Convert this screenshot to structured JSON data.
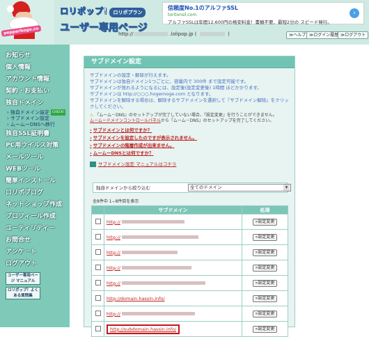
{
  "header": {
    "mascot_tag": "pepperbogo.co",
    "logo_line1": "ロリポップ!",
    "logo_badge": "ロリポプラン",
    "logo_line2": "ユーザー専用ページ",
    "url_prefix": "http://",
    "url_suffix": ".lolipop.jp",
    "help": "ヘルプ",
    "login_history": "ログイン履歴",
    "logout": "ログアウト"
  },
  "ad": {
    "title": "信頼度No.1のアルファSSL",
    "url": "toritonsil.com",
    "desc": "アルファSSLは年間12,600円の格安料金！書類不要、最短2分の スピード発行。"
  },
  "sidebar": {
    "items": [
      "お知らせ",
      "個人情報",
      "アカウント情報",
      "契約・お支払い",
      "独自ドメイン",
      "独自SSL証明書",
      "PC用ウイルス対策",
      "メールツール",
      "WEBツール",
      "簡単インストール",
      "ロリポブログ",
      "ネットショップ作成",
      "プロフィール作成",
      "ユーティリティー",
      "お問合せ",
      "アンケート",
      "ログアウト"
    ],
    "sub_items": [
      "独自ドメイン設定",
      "サブドメイン設定",
      "ムームーDNSへ移行"
    ],
    "sub_new": "CHECK!",
    "manual_button": "ユーザー専用ページ マニュアル",
    "faq_button": "ロリポップ！よくある質問集"
  },
  "panel": {
    "title": "サブドメイン設定",
    "intro": [
      "サブドメインの設定・解除が行えます。",
      "サブドメインは独自ドメイン1つごとに、容量内で 300件 まで設定可能です。",
      "サブドメインが見れるようになるには、設定後(設定変更後) 1時間 ほどかかります。",
      "サブドメインは http://○○○.hogemoge.com となります。",
      "サブドメインを解除する場合は、解除するサブドメインを選択して『サブドメイン解除』をクリックしてください。"
    ],
    "warn1": "『ムーム－DNS』のセットアップが完了していない場合、『設定変更』を行うことができません。",
    "warn2": "ムームードメインコントロールパネル",
    "warn3": "から『ムーム－DNS』のセットアップを完了してください。",
    "links": [
      "サブドメインとは何ですか？",
      "サブドメインを設定したのですが表示されません。",
      "サブドメインの階層作成が出来ません。",
      "ムームーDNSとは何ですか？"
    ],
    "manual_link": "サブドメイン設定 マニュアルはコチラ",
    "filter_label": "独自ドメインから絞り込む",
    "filter_value": "全てのドメイン",
    "count_text": "全8件中 1−8件目を表示",
    "col_subdomain": "サブドメイン",
    "col_action": "処理",
    "rows": [
      {
        "url": "http://"
      },
      {
        "url": "http://"
      },
      {
        "url": "http://"
      },
      {
        "url": "http://"
      },
      {
        "url": "http://"
      },
      {
        "url": "http://domain.hassin.info/"
      },
      {
        "url": "http://"
      },
      {
        "url": "http://subdomain.hassin.info/"
      }
    ],
    "action_label": "設定変更"
  }
}
